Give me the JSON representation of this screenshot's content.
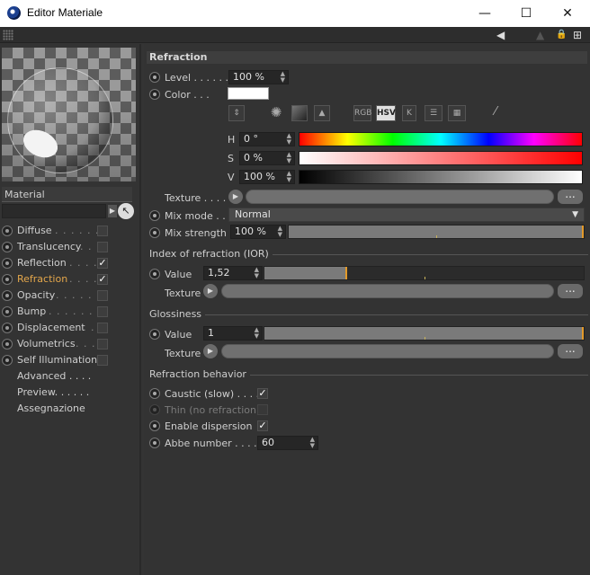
{
  "window": {
    "title": "Editor Materiale",
    "min_glyph": "—",
    "max_glyph": "☐",
    "close_glyph": "✕"
  },
  "toolbar": {
    "icons": [
      "arrow-left-icon",
      "arrow-up-icon",
      "lock-icon",
      "new-panel-icon"
    ],
    "arrow_glyph": "◀",
    "up_glyph": "▲",
    "lock_glyph": "🔒",
    "new_glyph": "⊞"
  },
  "left": {
    "section_label": "Material",
    "channels": [
      {
        "label": "Diffuse",
        "dots": ". . . . . . .",
        "checked": false,
        "active": false
      },
      {
        "label": "Translucency",
        "dots": ". . .",
        "checked": false,
        "active": false
      },
      {
        "label": "Reflection",
        "dots": ". . . .",
        "checked": true,
        "active": false
      },
      {
        "label": "Refraction",
        "dots": ". . . .",
        "checked": true,
        "active": true
      },
      {
        "label": "Opacity",
        "dots": ". . . . . . .",
        "checked": false,
        "active": false
      },
      {
        "label": "Bump",
        "dots": ". . . . . . . .",
        "checked": false,
        "active": false
      },
      {
        "label": "Displacement",
        "dots": ". . .",
        "checked": false,
        "active": false
      },
      {
        "label": "Volumetrics",
        "dots": ". . . .",
        "checked": false,
        "active": false
      },
      {
        "label": "Self Illumination",
        "dots": "",
        "checked": false,
        "active": false
      }
    ],
    "extra_items": [
      {
        "label": "Advanced . . . ."
      },
      {
        "label": "Preview. . . . . ."
      },
      {
        "label": "Assegnazione"
      }
    ]
  },
  "main": {
    "section_title": "Refraction",
    "level": {
      "label": "Level . . . . . . .",
      "value": "100 %"
    },
    "color": {
      "label": "Color . . .",
      "swatch": "#ffffff"
    },
    "color_modes": [
      "RGB",
      "HSV",
      "K"
    ],
    "active_mode": "HSV",
    "hsv": {
      "h": {
        "label": "H",
        "value": "0 °"
      },
      "s": {
        "label": "S",
        "value": "0 %"
      },
      "v": {
        "label": "V",
        "value": "100 %"
      }
    },
    "texture_label": "Texture . . . . .",
    "more_glyph": "...",
    "arrow_glyph": "▶",
    "mix_mode": {
      "label": "Mix mode . . .",
      "value": "Normal",
      "caret": "▼"
    },
    "mix_strength": {
      "label": "Mix strength",
      "value": "100 %",
      "fraction": 1.0
    },
    "ior": {
      "header": "Index of refraction (IOR)",
      "value_label": "Value",
      "value": "1,52",
      "fraction": 0.26,
      "texture_label": "Texture"
    },
    "glossiness": {
      "header": "Glossiness",
      "value_label": "Value",
      "value": "1",
      "fraction": 1.0,
      "texture_label": "Texture"
    },
    "behavior": {
      "header": "Refraction behavior",
      "items": [
        {
          "label": "Caustic (slow) . . . .",
          "checked": true,
          "enabled": true
        },
        {
          "label": "Thin (no refraction)",
          "checked": false,
          "enabled": false
        },
        {
          "label": "Enable dispersion",
          "checked": true,
          "enabled": true
        }
      ],
      "abbe": {
        "label": "Abbe number . . . .",
        "value": "60"
      }
    }
  },
  "colors": {
    "accent": "#e3a64b",
    "handle": "#e39a2a",
    "background": "#333333"
  }
}
